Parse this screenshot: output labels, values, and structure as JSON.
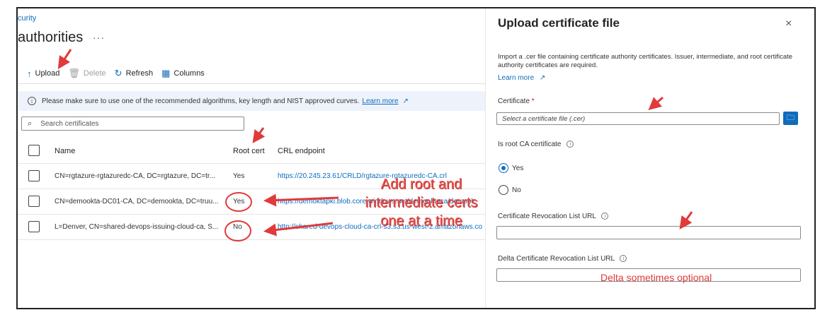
{
  "breadcrumb": "curity",
  "page_title": "authorities",
  "more_label": "···",
  "toolbar": {
    "upload": "Upload",
    "delete": "Delete",
    "refresh": "Refresh",
    "columns": "Columns"
  },
  "info_bar": {
    "text": "Please make sure to use one of the recommended algorithms, key length and NIST approved curves.",
    "link": "Learn more"
  },
  "search": {
    "placeholder": "Search certificates"
  },
  "table": {
    "headers": {
      "name": "Name",
      "root": "Root cert",
      "crl": "CRL endpoint"
    },
    "rows": [
      {
        "name": "CN=rgtazure-rgtazuredc-CA, DC=rgtazure, DC=tr...",
        "root": "Yes",
        "crl": "https://20.245.23.61/CRLD/rgtazure-rgtazuredc-CA.crl"
      },
      {
        "name": "CN=demookta-DC01-CA, DC=demookta, DC=truu...",
        "root": "Yes",
        "crl": "https://demoktapki.blob.core.windows.net/demooktaca/demook"
      },
      {
        "name": "L=Denver, CN=shared-devops-issuing-cloud-ca, S...",
        "root": "No",
        "crl": "http://shared-devops-cloud-ca-crl-s3.s3.us-west-2.amazonaws.co"
      }
    ]
  },
  "panel": {
    "title": "Upload certificate file",
    "close": "×",
    "description": "Import a .cer file containing certificate authority certificates. Issuer, intermediate, and root certificate authority certificates are required.",
    "learn_more": "Learn more",
    "certificate_label": "Certificate",
    "required_mark": "*",
    "certificate_placeholder": "Select a certificate file (.cer)",
    "is_root_label": "Is root CA certificate",
    "yes": "Yes",
    "no": "No",
    "is_root_value": "Yes",
    "crl_label": "Certificate Revocation List URL",
    "delta_crl_label": "Delta Certificate Revocation List URL"
  },
  "annotations": {
    "main_line1": "Add root and",
    "main_line2": "intermediate certs",
    "main_line3": "one at a time",
    "delta": "Delta sometimes optional"
  },
  "colors": {
    "accent": "#0f6cbd",
    "annotation": "#e03a3a"
  }
}
